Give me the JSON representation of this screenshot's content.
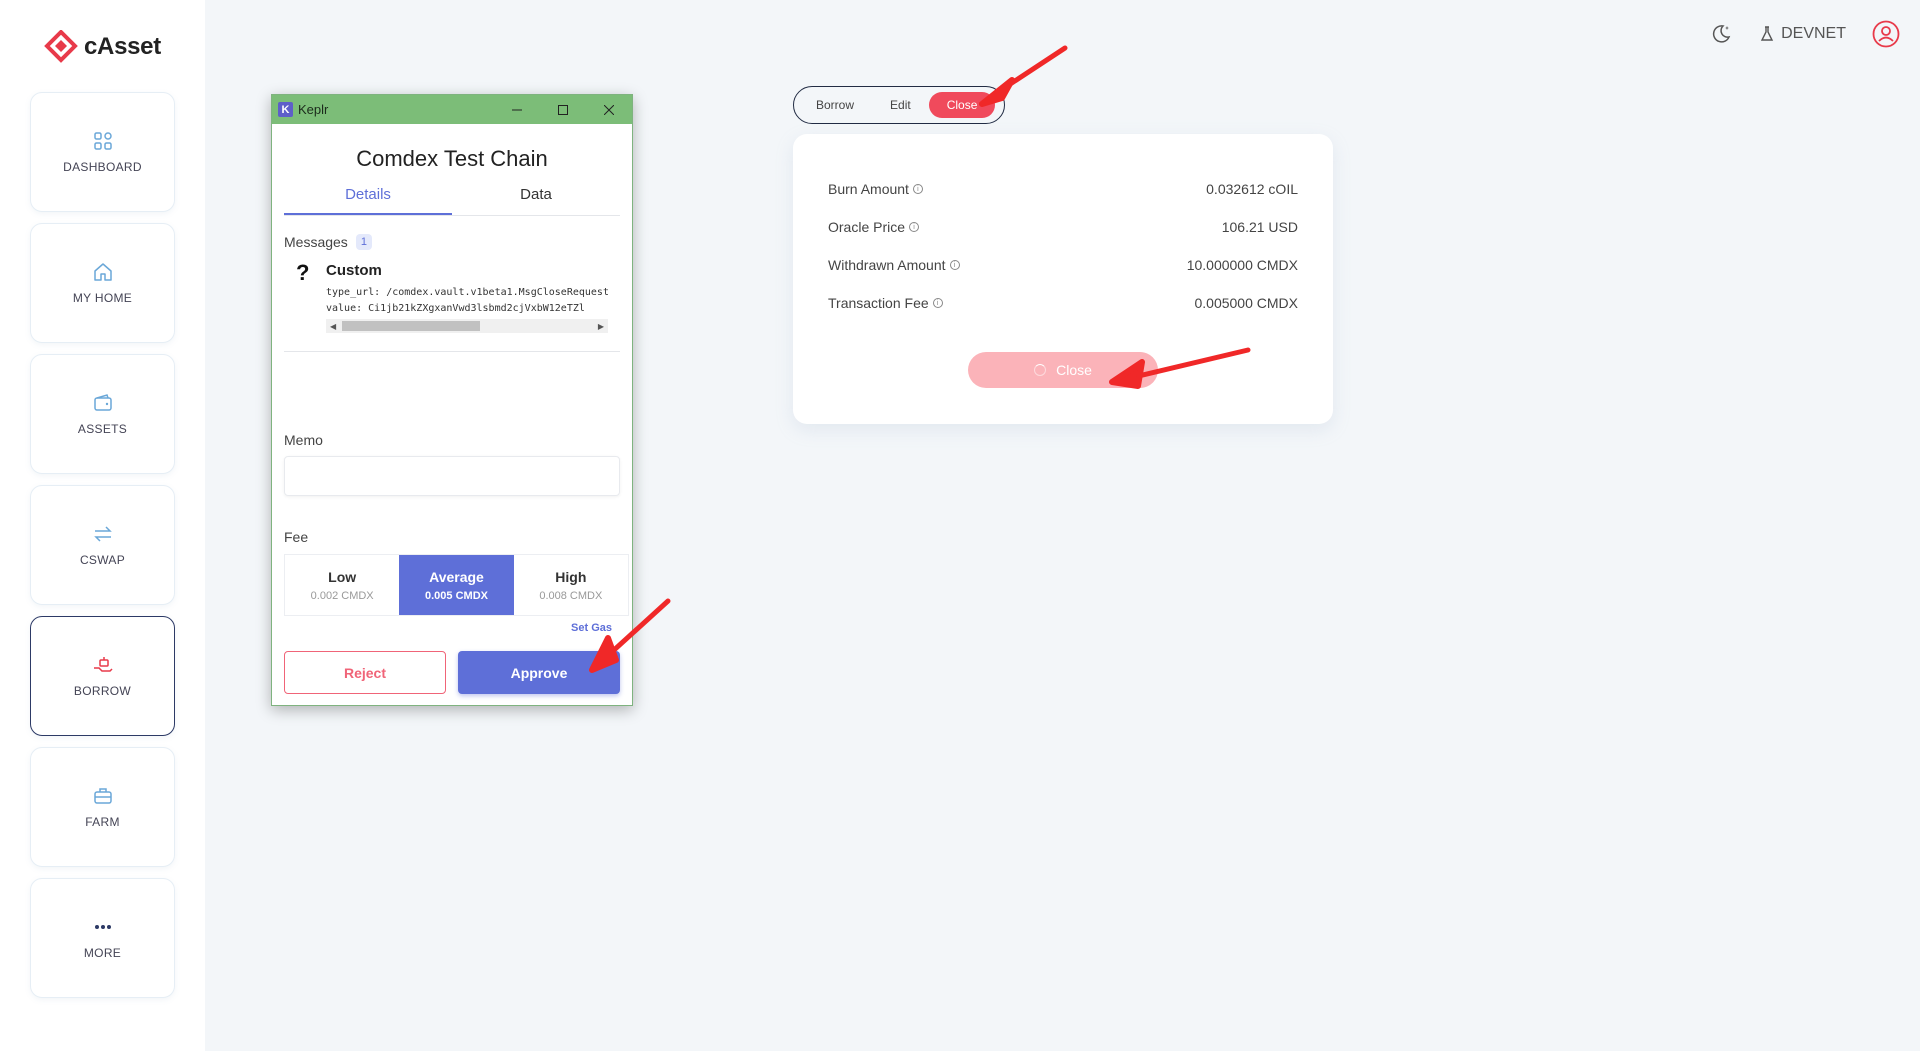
{
  "app": {
    "name": "cAsset"
  },
  "sidebar": {
    "items": [
      {
        "label": "DASHBOARD",
        "icon": "grid-icon"
      },
      {
        "label": "MY HOME",
        "icon": "home-icon"
      },
      {
        "label": "ASSETS",
        "icon": "wallet-icon"
      },
      {
        "label": "CSWAP",
        "icon": "swap-icon"
      },
      {
        "label": "BORROW",
        "icon": "borrow-icon",
        "active": true
      },
      {
        "label": "FARM",
        "icon": "briefcase-icon"
      },
      {
        "label": "MORE",
        "icon": "more-icon"
      }
    ]
  },
  "topbar": {
    "network": "DEVNET"
  },
  "keplr": {
    "window_title": "Keplr",
    "logo_letter": "K",
    "chain_name": "Comdex Test Chain",
    "tabs": [
      "Details",
      "Data"
    ],
    "messages_label": "Messages",
    "messages_count": "1",
    "message": {
      "icon": "?",
      "type": "Custom",
      "type_url": "type_url: /comdex.vault.v1beta1.MsgCloseRequest",
      "value": "value: Ci1jb21kZXgxanVwd3lsbmd2cjVxbW12eTZl"
    },
    "memo_label": "Memo",
    "fee_label": "Fee",
    "fees": [
      {
        "name": "Low",
        "amount": "0.002 CMDX"
      },
      {
        "name": "Average",
        "amount": "0.005 CMDX",
        "selected": true
      },
      {
        "name": "High",
        "amount": "0.008 CMDX"
      }
    ],
    "set_gas": "Set Gas",
    "reject": "Reject",
    "approve": "Approve"
  },
  "action_tabs": [
    "Borrow",
    "Edit",
    "Close"
  ],
  "close_card": {
    "rows": [
      {
        "label": "Burn Amount",
        "value": "0.032612 cOIL"
      },
      {
        "label": "Oracle Price",
        "value": "106.21 USD"
      },
      {
        "label": "Withdrawn Amount",
        "value": "10.000000 CMDX"
      },
      {
        "label": "Transaction Fee",
        "value": "0.005000 CMDX"
      }
    ],
    "button": "Close"
  },
  "colors": {
    "accent": "#5e6fd8",
    "brand_red": "#f04a5c",
    "keplr_titlebar": "#7cbd78",
    "annotation_arrow": "#f02828"
  }
}
